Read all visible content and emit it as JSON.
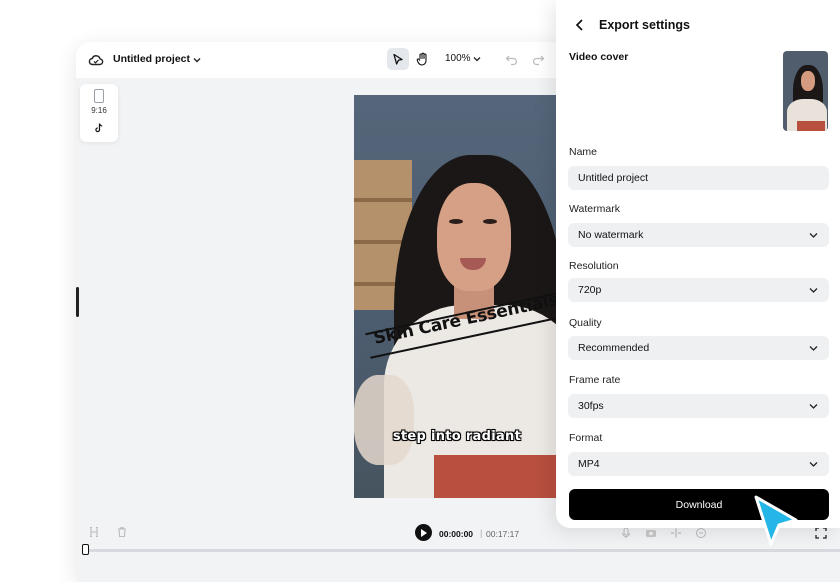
{
  "editor": {
    "project_name": "Untitled project",
    "zoom": "100%",
    "aspect_ratio": "9:16",
    "video": {
      "title_overlay": "Skin Care Essentials",
      "caption": "step into radiant"
    },
    "playback": {
      "current_time": "00:00:00",
      "separator": "|",
      "total_time": "00:17:17"
    }
  },
  "export_panel": {
    "title": "Export settings",
    "video_cover_label": "Video cover",
    "fields": [
      {
        "label": "Name",
        "value": "Untitled project",
        "type": "text"
      },
      {
        "label": "Watermark",
        "value": "No watermark",
        "type": "select"
      },
      {
        "label": "Resolution",
        "value": "720p",
        "type": "select"
      },
      {
        "label": "Quality",
        "value": "Recommended",
        "type": "select"
      },
      {
        "label": "Frame rate",
        "value": "30fps",
        "type": "select"
      },
      {
        "label": "Format",
        "value": "MP4",
        "type": "select"
      }
    ],
    "download_label": "Download"
  },
  "colors": {
    "accent_cursor": "#23b6e6",
    "button": "#000000"
  }
}
